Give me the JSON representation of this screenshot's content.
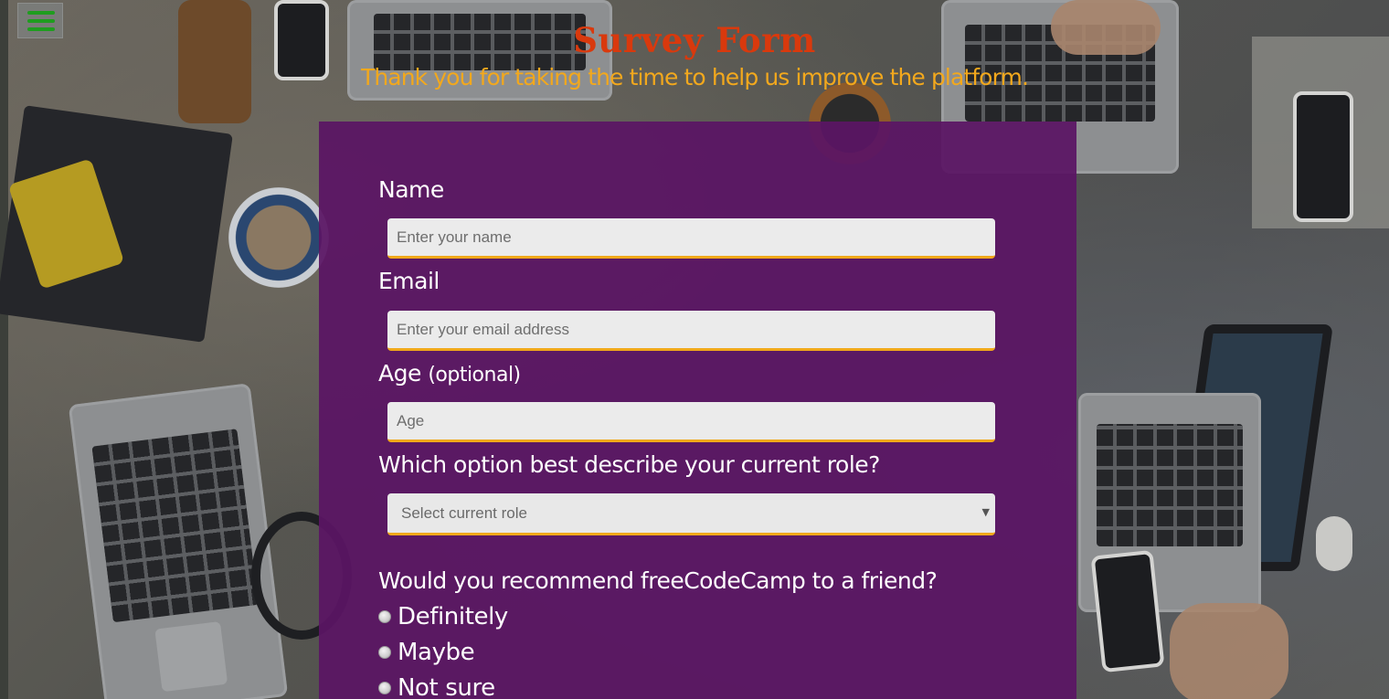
{
  "colors": {
    "title": "#d9390d",
    "subtitle": "#f2a81d",
    "panel": "#5a1464",
    "input_accent": "#f0a81a",
    "menu_icon": "#1f9d1f"
  },
  "header": {
    "menu_icon": "hamburger-menu-icon",
    "title": "Survey Form",
    "subtitle": "Thank you for taking the time to help us improve the platform."
  },
  "form": {
    "name": {
      "label": "Name",
      "placeholder": "Enter your name",
      "value": ""
    },
    "email": {
      "label": "Email",
      "placeholder": "Enter your email address",
      "value": ""
    },
    "age": {
      "label": "Age",
      "label_suffix": "(optional)",
      "placeholder": "Age",
      "value": ""
    },
    "role": {
      "label": "Which option best describe your current role?",
      "selected": "Select current role",
      "caret_icon": "caret-down-icon"
    },
    "recommend": {
      "question": "Would you recommend freeCodeCamp to a friend?",
      "options": [
        "Definitely",
        "Maybe",
        "Not sure"
      ]
    }
  }
}
